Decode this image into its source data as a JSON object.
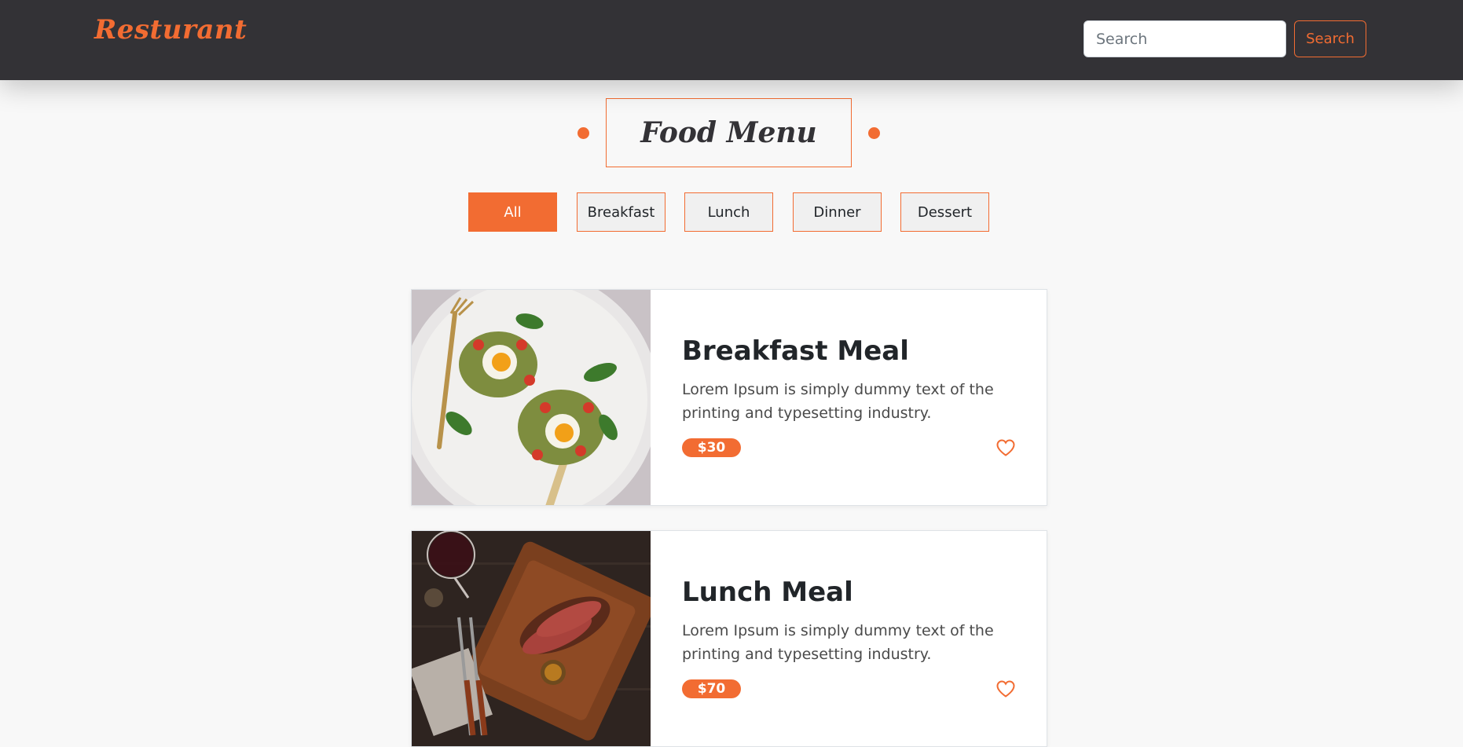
{
  "navbar": {
    "brand": "Resturant",
    "search_placeholder": "Search",
    "search_value": "",
    "search_button": "Search"
  },
  "menu": {
    "title": "Food Menu",
    "filters": [
      {
        "label": "All",
        "active": true
      },
      {
        "label": "Breakfast",
        "active": false
      },
      {
        "label": "Lunch",
        "active": false
      },
      {
        "label": "Dinner",
        "active": false
      },
      {
        "label": "Dessert",
        "active": false
      }
    ]
  },
  "items": [
    {
      "title": "Breakfast Meal",
      "description": "Lorem Ipsum is simply dummy text of the printing and typesetting industry.",
      "price": "$30",
      "image": "breakfast-plate-photo"
    },
    {
      "title": "Lunch Meal",
      "description": "Lorem Ipsum is simply dummy text of the printing and typesetting industry.",
      "price": "$70",
      "image": "steak-board-photo"
    }
  ],
  "colors": {
    "accent": "#f26c32",
    "navbar_bg": "#333236",
    "page_bg": "#f8f8f8"
  }
}
